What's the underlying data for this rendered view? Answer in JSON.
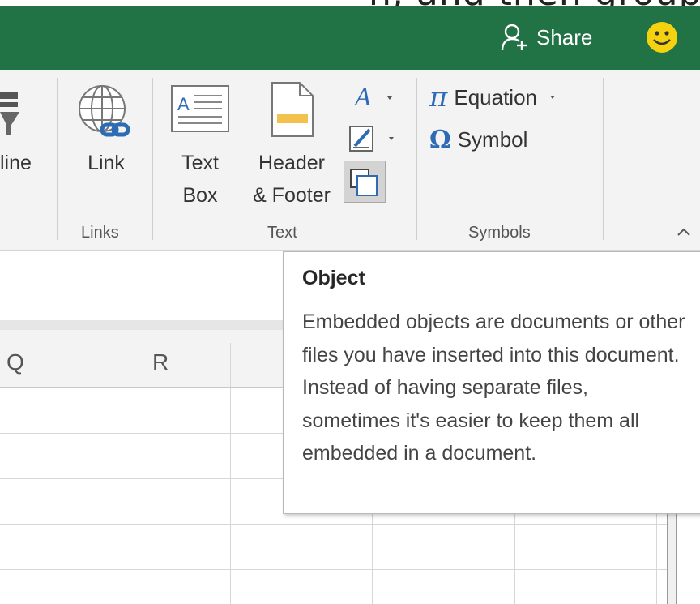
{
  "top_strip": {
    "text": "n, and then grouping,"
  },
  "titlebar": {
    "share_label": "Share",
    "accent": "#217346"
  },
  "ribbon": {
    "partial_label": "line",
    "link_label": "Link",
    "links_group": "Links",
    "textbox_label_1": "Text",
    "textbox_label_2": "Box",
    "header_label_1": "Header",
    "header_label_2": "& Footer",
    "text_group": "Text",
    "equation_label": "Equation",
    "symbol_label": "Symbol",
    "symbols_group": "Symbols",
    "collapse_glyph": "^"
  },
  "grid": {
    "columns": [
      "Q",
      "R"
    ]
  },
  "tooltip": {
    "title": "Object",
    "body": "Embedded objects are documents or other files you have inserted into this document. Instead of having separate files, sometimes it's easier to keep them all embedded in a document."
  }
}
